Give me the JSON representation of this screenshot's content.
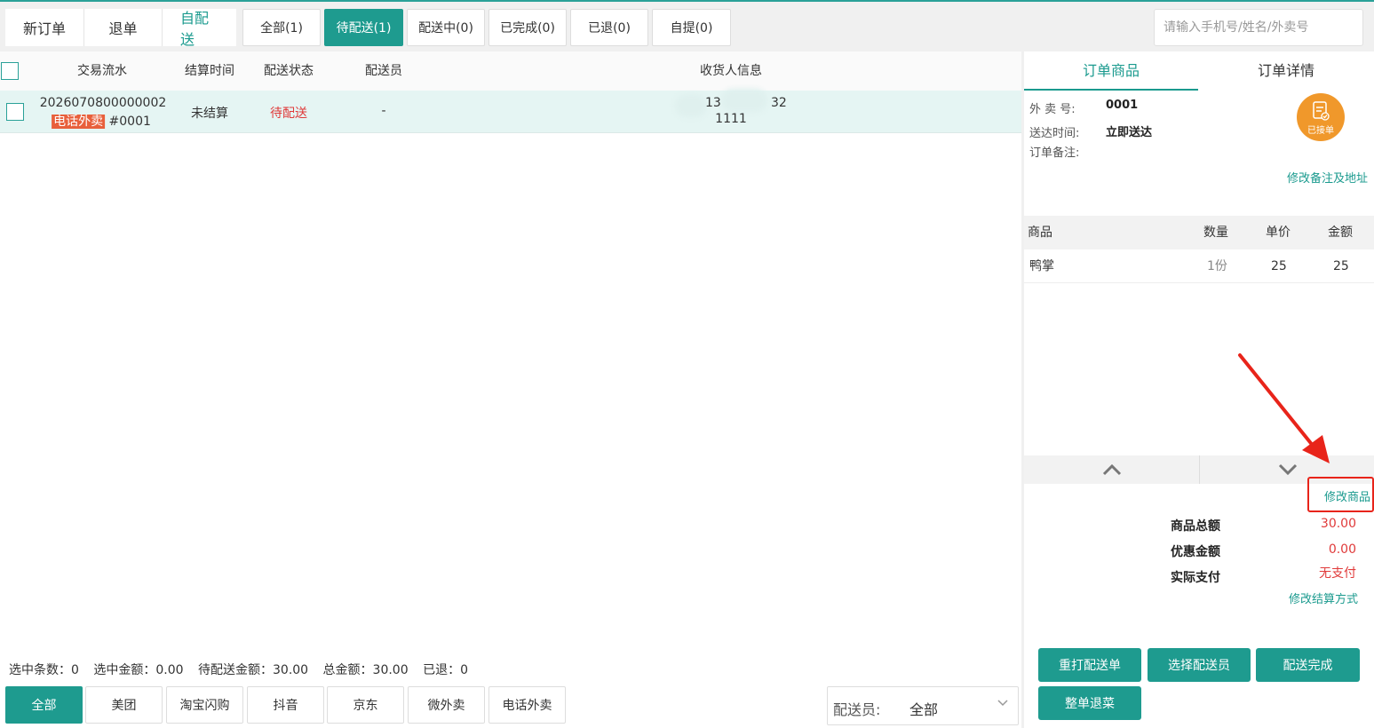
{
  "topbar": {
    "mode_tabs": [
      "新订单",
      "退单",
      "自配送"
    ],
    "status_tabs": [
      "全部(1)",
      "待配送(1)",
      "配送中(0)",
      "已完成(0)",
      "已退(0)",
      "自提(0)"
    ],
    "search_placeholder": "请输入手机号/姓名/外卖号"
  },
  "table": {
    "headers": [
      "交易流水",
      "结算时间",
      "配送状态",
      "配送员",
      "收货人信息"
    ],
    "rows": [
      {
        "serial": "2026070800000002",
        "source_tag": "电话外卖",
        "order_no": "#0001",
        "settle_time": "未结算",
        "status": "待配送",
        "rider": "-",
        "phone_start": "13",
        "phone_end": "32",
        "address": "1111"
      }
    ]
  },
  "summary": {
    "selected_count": "选中条数：0",
    "selected_amount": "选中金额：0.00",
    "pending_amount": "待配送金额：30.00",
    "total_amount": "总金额：30.00",
    "refunded": "已退：0"
  },
  "source_tabs": [
    "全部",
    "美团",
    "淘宝闪购",
    "抖音",
    "京东",
    "微外卖",
    "电话外卖"
  ],
  "rider_filter": {
    "label": "配送员:",
    "value": "全部"
  },
  "detail": {
    "tabs": [
      "订单商品",
      "订单详情"
    ],
    "takeout_no_label": "外 卖 号:",
    "takeout_no": "0001",
    "delivery_time_label": "送达时间:",
    "delivery_time": "立即送达",
    "remark_label": "订单备注:",
    "badge": "已接单",
    "edit_remark_link": "修改备注及地址",
    "goods_headers": [
      "商品",
      "数量",
      "单价",
      "金额"
    ],
    "goods": [
      {
        "name": "鸭掌",
        "qty": "1份",
        "price": "25",
        "amount": "25"
      }
    ],
    "edit_goods_link": "修改商品",
    "totals": [
      {
        "label": "商品总额",
        "value": "30.00"
      },
      {
        "label": "优惠金额",
        "value": "0.00"
      },
      {
        "label": "实际支付",
        "value": "无支付"
      }
    ],
    "edit_payment_link": "修改结算方式",
    "buttons": [
      "重打配送单",
      "选择配送员",
      "配送完成",
      "整单退菜"
    ]
  },
  "colors": {
    "accent": "#1e9b8f",
    "warning": "#e03a3a",
    "badge": "#f0982b",
    "highlight": "#e8241a"
  }
}
